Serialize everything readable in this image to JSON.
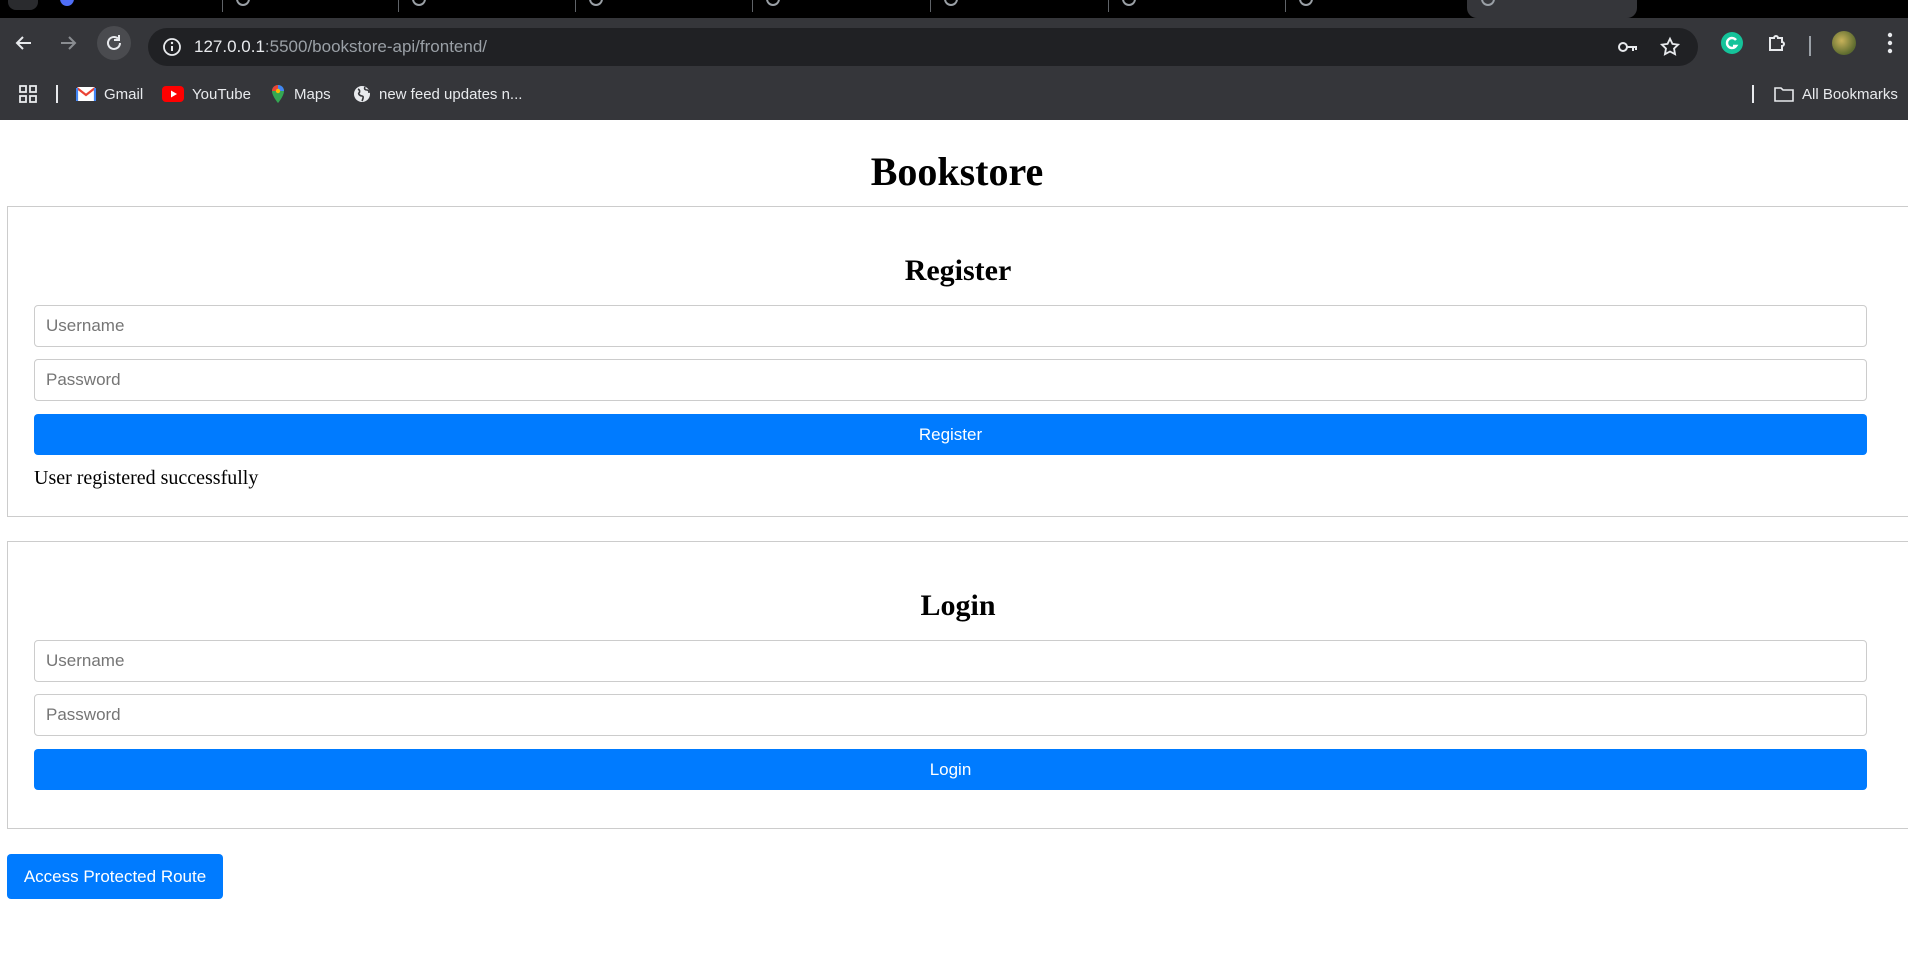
{
  "browser": {
    "url_host": "127.0.0.1",
    "url_rest": ":5500/bookstore-api/frontend/",
    "bookmarks": [
      {
        "label": "Gmail",
        "icon": "gmail-icon"
      },
      {
        "label": "YouTube",
        "icon": "youtube-icon"
      },
      {
        "label": "Maps",
        "icon": "maps-icon"
      },
      {
        "label": "new feed updates n...",
        "icon": "globe-icon"
      }
    ],
    "all_bookmarks_label": "All Bookmarks"
  },
  "page": {
    "title": "Bookstore",
    "register": {
      "heading": "Register",
      "username_placeholder": "Username",
      "password_placeholder": "Password",
      "button_label": "Register",
      "status_message": "User registered successfully"
    },
    "login": {
      "heading": "Login",
      "username_placeholder": "Username",
      "password_placeholder": "Password",
      "button_label": "Login"
    },
    "protected_button_label": "Access Protected Route"
  },
  "colors": {
    "accent": "#007bff",
    "chrome_bg": "#35363a",
    "omnibox_bg": "#202124"
  }
}
